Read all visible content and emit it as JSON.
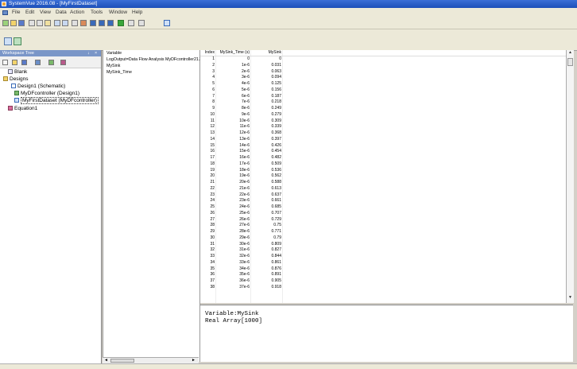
{
  "window": {
    "title": "SystemVue 2016.08 - [MyFirstDataset]"
  },
  "menu": [
    "File",
    "Edit",
    "View",
    "Data",
    "Action",
    "Tools",
    "Window",
    "Help"
  ],
  "workspace": {
    "title": "Workspace Tree",
    "pin": "↓",
    "close": "×",
    "tree": [
      {
        "label": "Blank"
      },
      {
        "label": "Designs"
      },
      {
        "label": "Design1 (Schematic)"
      },
      {
        "label": "MyDFcontroller (Design1)"
      },
      {
        "label": "MyFirstDataset (MyDFcontroller)"
      },
      {
        "label": "Equation1"
      }
    ]
  },
  "variables": {
    "header": "Variable",
    "items": [
      "LogOutput=Data Flow Analysis   MyDFcontroller21.3..",
      "MySink",
      "MySink_Time"
    ]
  },
  "grid": {
    "columns": [
      "Index",
      "MySink_Time (s)",
      "MySink"
    ],
    "rows": [
      [
        "1",
        "0",
        "0"
      ],
      [
        "2",
        "1e-6",
        "0.031"
      ],
      [
        "3",
        "2e-6",
        "0.063"
      ],
      [
        "4",
        "3e-6",
        "0.094"
      ],
      [
        "5",
        "4e-6",
        "0.125"
      ],
      [
        "6",
        "5e-6",
        "0.156"
      ],
      [
        "7",
        "6e-6",
        "0.187"
      ],
      [
        "8",
        "7e-6",
        "0.218"
      ],
      [
        "9",
        "8e-6",
        "0.249"
      ],
      [
        "10",
        "9e-6",
        "0.279"
      ],
      [
        "11",
        "10e-6",
        "0.309"
      ],
      [
        "12",
        "11e-6",
        "0.339"
      ],
      [
        "13",
        "12e-6",
        "0.368"
      ],
      [
        "14",
        "13e-6",
        "0.397"
      ],
      [
        "15",
        "14e-6",
        "0.426"
      ],
      [
        "16",
        "15e-6",
        "0.454"
      ],
      [
        "17",
        "16e-6",
        "0.482"
      ],
      [
        "18",
        "17e-6",
        "0.509"
      ],
      [
        "19",
        "18e-6",
        "0.536"
      ],
      [
        "20",
        "19e-6",
        "0.562"
      ],
      [
        "21",
        "20e-6",
        "0.588"
      ],
      [
        "22",
        "21e-6",
        "0.613"
      ],
      [
        "23",
        "22e-6",
        "0.637"
      ],
      [
        "24",
        "23e-6",
        "0.661"
      ],
      [
        "25",
        "24e-6",
        "0.685"
      ],
      [
        "26",
        "25e-6",
        "0.707"
      ],
      [
        "27",
        "26e-6",
        "0.729"
      ],
      [
        "28",
        "27e-6",
        "0.75"
      ],
      [
        "29",
        "28e-6",
        "0.771"
      ],
      [
        "30",
        "29e-6",
        "0.79"
      ],
      [
        "31",
        "30e-6",
        "0.809"
      ],
      [
        "32",
        "31e-6",
        "0.827"
      ],
      [
        "33",
        "32e-6",
        "0.844"
      ],
      [
        "34",
        "33e-6",
        "0.861"
      ],
      [
        "35",
        "34e-6",
        "0.876"
      ],
      [
        "36",
        "35e-6",
        "0.891"
      ],
      [
        "37",
        "36e-6",
        "0.905"
      ],
      [
        "38",
        "37e-6",
        "0.918"
      ]
    ]
  },
  "console": {
    "lines": [
      "Variable:MySink",
      "Real Array[1000]"
    ]
  },
  "scroll": {
    "up": "▲",
    "down": "▼"
  },
  "hscroll_left": "◄",
  "hscroll_right": "►"
}
